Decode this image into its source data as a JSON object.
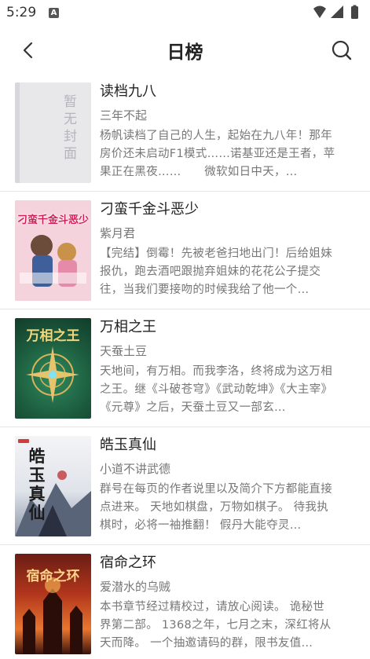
{
  "status_bar": {
    "time": "5:29",
    "notification_icon_letter": "A",
    "icons": [
      "wifi-icon",
      "cellular-icon",
      "battery-icon"
    ]
  },
  "header": {
    "title": "日榜",
    "back_icon": "chevron-left-icon",
    "search_icon": "search-icon"
  },
  "books": [
    {
      "title": "读档九八",
      "author": "三年不起",
      "description": "杨帆读档了自己的人生，起始在九八年！那年房价还未启动F1模式……诺基亚还是王者，苹果正在黑夜……　　微软如日中天，…",
      "cover_text": "暂无封面"
    },
    {
      "title": "刁蛮千金斗恶少",
      "author": "紫月君",
      "description": "【完结】倒霉！先被老爸扫地出门！后给姐妹报仇，跑去酒吧跟抛弃姐妹的花花公子提交往，当我们要接吻的时候我给了他一个…",
      "cover_text": "刁蛮千金斗恶少"
    },
    {
      "title": "万相之王",
      "author": "天蚕土豆",
      "description": "天地间，有万相。而我李洛，终将成为这万相之王。继《斗破苍穹》《武动乾坤》《大主宰》《元尊》之后，天蚕土豆又一部玄…",
      "cover_text": "万相之王"
    },
    {
      "title": "皓玉真仙",
      "author": "小道不讲武德",
      "description": "群号在每页的作者说里以及简介下方都能直接点进来。 天地如棋盘，万物如棋子。 待我执棋时，必将一袖推翻！ 假丹大能夺灵…",
      "cover_text": "皓玉真仙"
    },
    {
      "title": "宿命之环",
      "author": "爱潜水的乌贼",
      "description": "本书章节经过精校过，请放心阅读。 诡秘世界第二部。 1368之年，七月之末，深红将从天而降。 一个抽邀请码的群，限书友值…",
      "cover_text": "宿命之环"
    }
  ]
}
